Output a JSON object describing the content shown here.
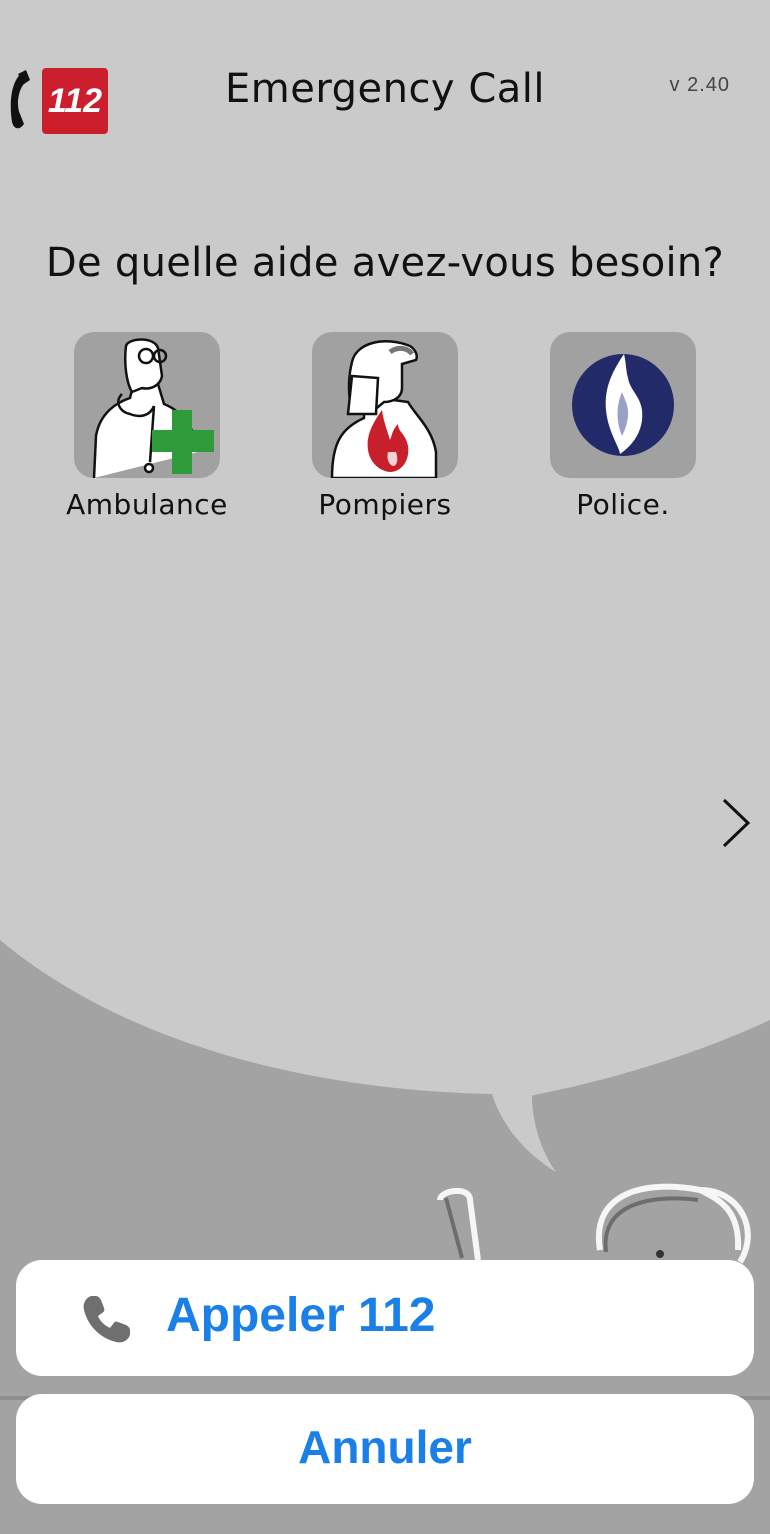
{
  "header": {
    "logo_text": "112",
    "title": "Emergency Call",
    "version": "v 2.40"
  },
  "question": "De quelle aide avez-vous besoin?",
  "services": [
    {
      "label": "Ambulance",
      "icon": "doctor-icon"
    },
    {
      "label": "Pompiers",
      "icon": "firefighter-icon"
    },
    {
      "label": "Police.",
      "icon": "police-flame-icon"
    }
  ],
  "next_icon": "chevron-right-icon",
  "action_sheet": {
    "call_label": "Appeler 112",
    "call_icon": "phone-icon",
    "cancel_label": "Annuler"
  },
  "colors": {
    "accent": "#1a7fe6",
    "logo_red": "#cc1f2d",
    "cross_green": "#2f9a3a",
    "police_blue": "#232a6a",
    "bubble": "#cbcacb",
    "background": "#a4a3a4"
  }
}
